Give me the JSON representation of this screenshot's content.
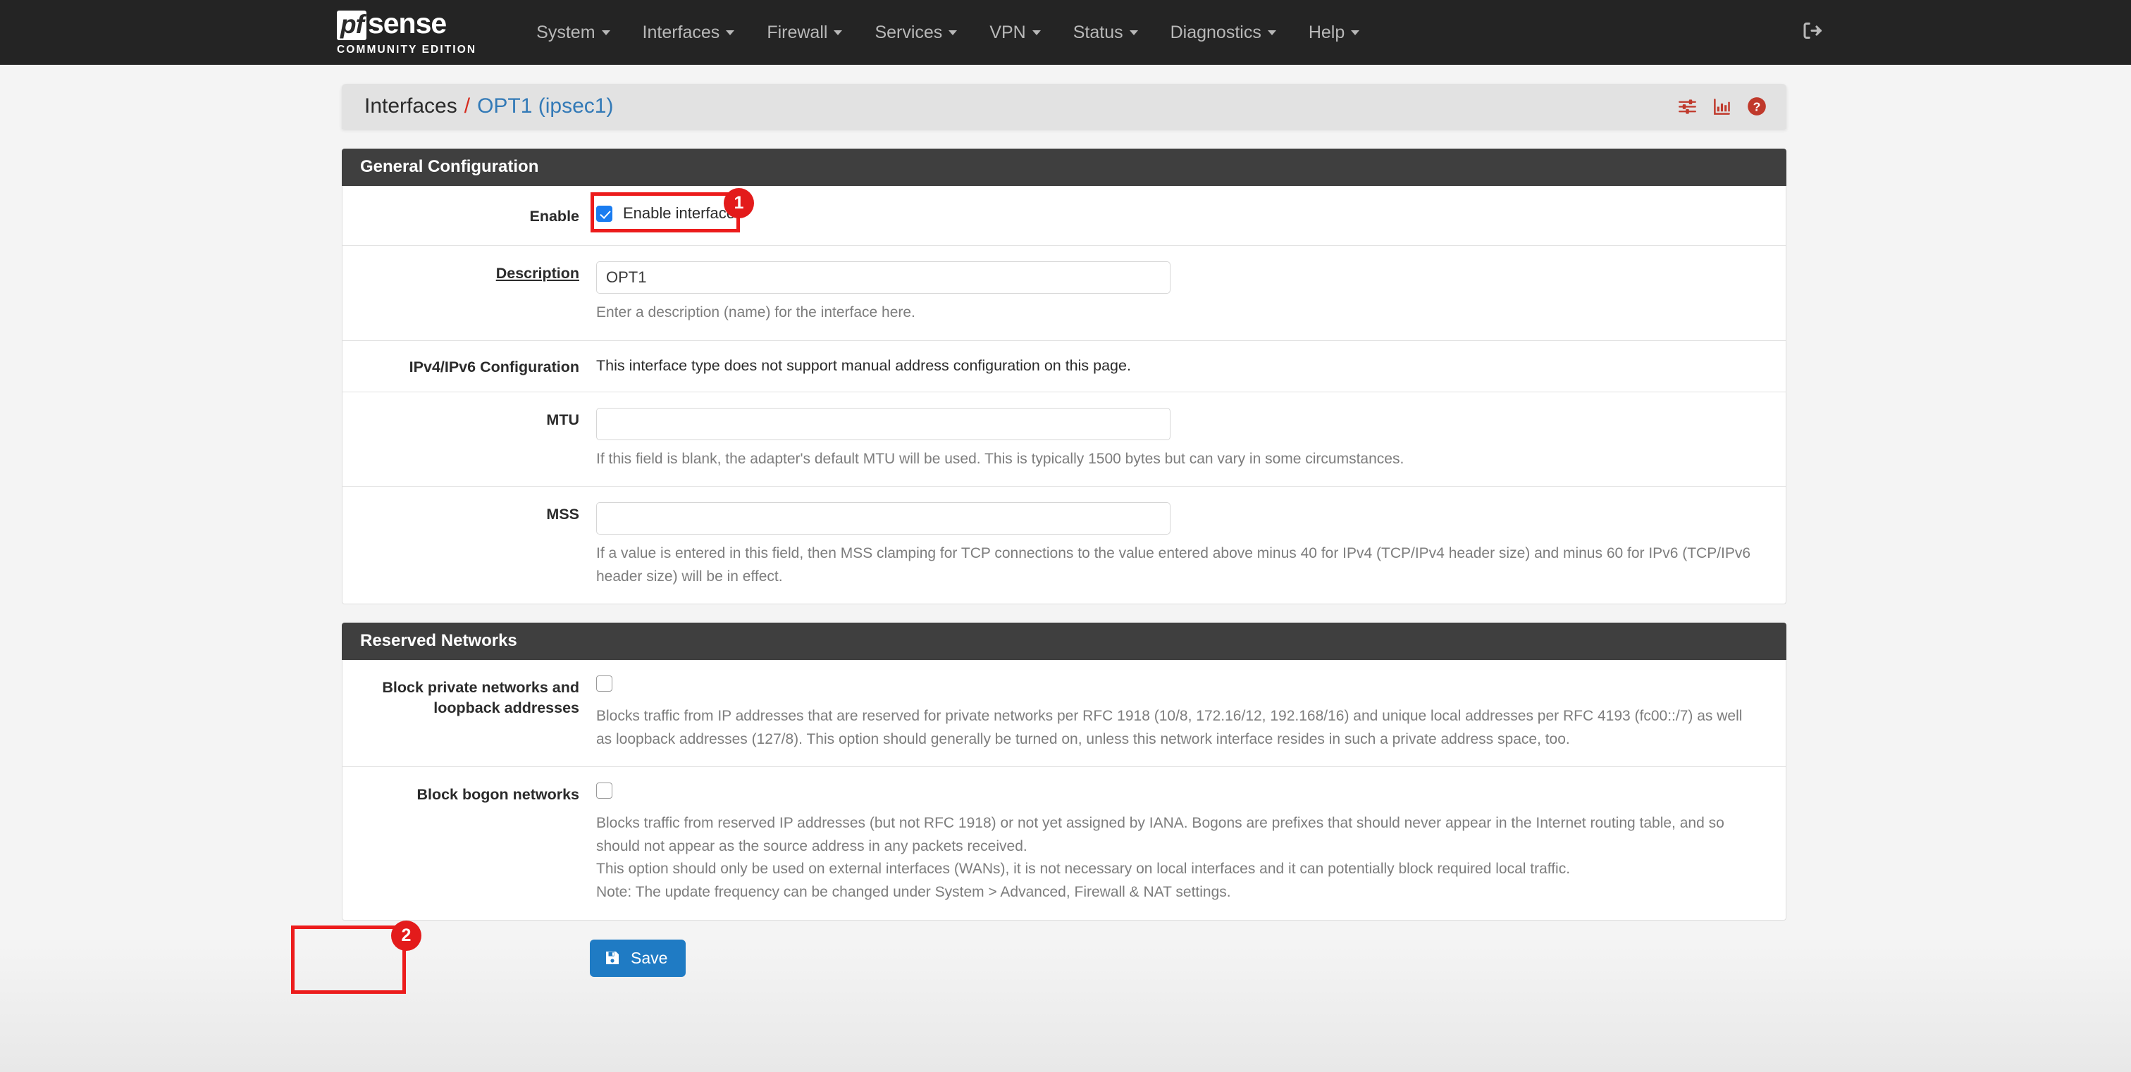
{
  "navbar": {
    "brand_pf": "pf",
    "brand_sense": "sense",
    "brand_sub": "COMMUNITY EDITION",
    "items": [
      {
        "label": "System"
      },
      {
        "label": "Interfaces"
      },
      {
        "label": "Firewall"
      },
      {
        "label": "Services"
      },
      {
        "label": "VPN"
      },
      {
        "label": "Status"
      },
      {
        "label": "Diagnostics"
      },
      {
        "label": "Help"
      }
    ],
    "logout_icon": "logout-icon"
  },
  "header": {
    "breadcrumb_root": "Interfaces",
    "breadcrumb_sep": "/",
    "breadcrumb_current": "OPT1 (ipsec1)",
    "icons": [
      "sliders-icon",
      "bar-chart-icon",
      "help-circle-icon"
    ],
    "icon_color": "#c0392b"
  },
  "general": {
    "title": "General Configuration",
    "enable": {
      "label": "Enable",
      "checkbox_label": "Enable interface",
      "checked": true
    },
    "description": {
      "label": "Description",
      "value": "OPT1",
      "help": "Enter a description (name) for the interface here."
    },
    "ip_config": {
      "label": "IPv4/IPv6 Configuration",
      "text": "This interface type does not support manual address configuration on this page."
    },
    "mtu": {
      "label": "MTU",
      "value": "",
      "help": "If this field is blank, the adapter's default MTU will be used. This is typically 1500 bytes but can vary in some circumstances."
    },
    "mss": {
      "label": "MSS",
      "value": "",
      "help": "If a value is entered in this field, then MSS clamping for TCP connections to the value entered above minus 40 for IPv4 (TCP/IPv4 header size) and minus 60 for IPv6 (TCP/IPv6 header size) will be in effect."
    }
  },
  "reserved": {
    "title": "Reserved Networks",
    "block_private": {
      "label": "Block private networks and loopback addresses",
      "checked": false,
      "help": "Blocks traffic from IP addresses that are reserved for private networks per RFC 1918 (10/8, 172.16/12, 192.168/16) and unique local addresses per RFC 4193 (fc00::/7) as well as loopback addresses (127/8). This option should generally be turned on, unless this network interface resides in such a private address space, too."
    },
    "block_bogon": {
      "label": "Block bogon networks",
      "checked": false,
      "help_line1": "Blocks traffic from reserved IP addresses (but not RFC 1918) or not yet assigned by IANA. Bogons are prefixes that should never appear in the Internet routing table, and so should not appear as the source address in any packets received.",
      "help_line2": "This option should only be used on external interfaces (WANs), it is not necessary on local interfaces and it can potentially block required local traffic.",
      "help_line3": "Note: The update frequency can be changed under System > Advanced, Firewall & NAT settings."
    }
  },
  "actions": {
    "save_label": "Save",
    "save_icon": "floppy-disk-icon"
  },
  "annotations": [
    {
      "number": "1",
      "target": "enable-interface-checkbox"
    },
    {
      "number": "2",
      "target": "save-button"
    }
  ]
}
